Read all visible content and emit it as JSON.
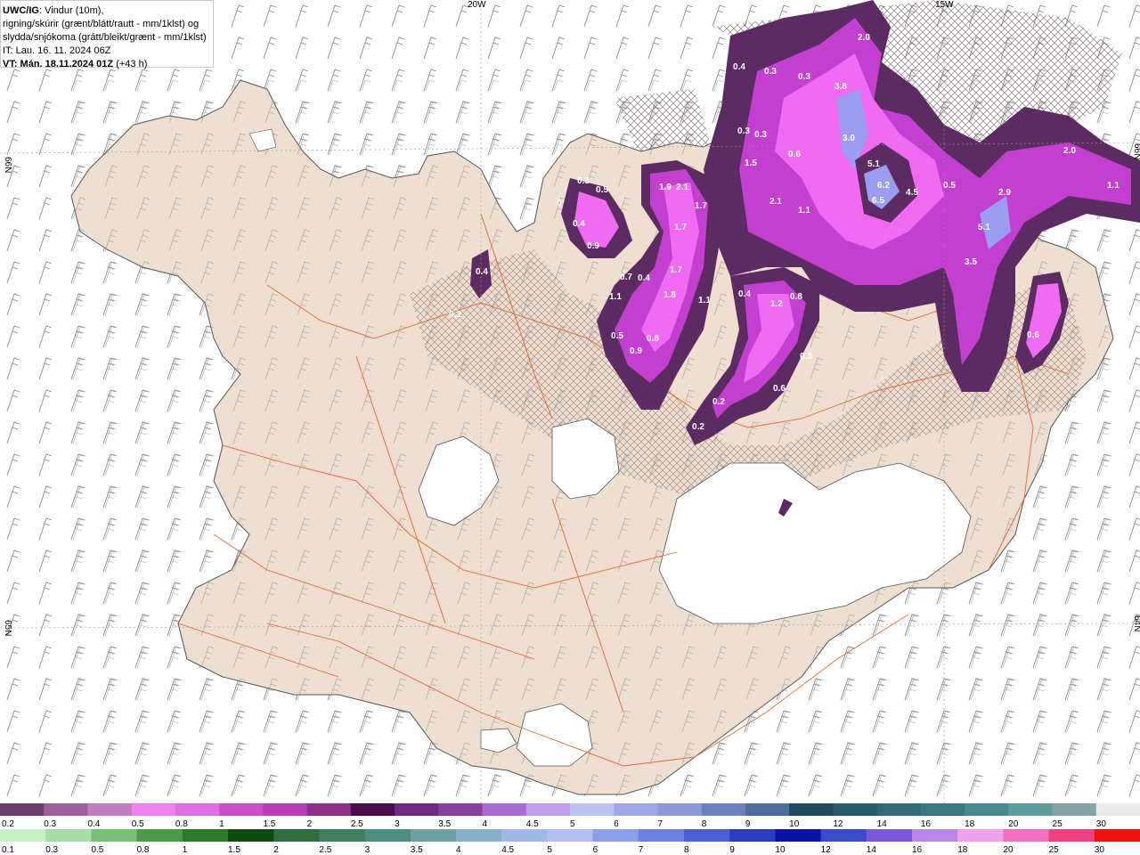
{
  "header": {
    "model": "UWC/IG",
    "line1": ": Vindur (10m),",
    "line2": "rigning/skúrir (grænt/blátt/rautt - mm/1klst) og",
    "line3": "slydda/snjókoma (grátt/bleikt/grænt - mm/1klst)",
    "issue_time": "IT: Lau. 16. 11. 2024 06Z",
    "valid_label": "VT: Mán. 18.11.2024 01Z",
    "lead": " (+43 h)"
  },
  "grid_labels": {
    "top_20w": "20W",
    "top_15w": "15W",
    "left_66n": "66N",
    "left_65n": "65N",
    "right_66n": "66N",
    "right_64n": "64N"
  },
  "colors": {
    "land": "#efdfd0",
    "sea": "#ffffff",
    "glacier": "#ffffff",
    "roads": "#e2672f",
    "coast": "#555555",
    "barbs": "#888888",
    "snow_light": "#9a4f9a",
    "snow_mid": "#c23fcf",
    "snow_bright": "#f06af2",
    "snow_dark": "#5b2b62",
    "snow_blue": "#9c9cf0"
  },
  "map_values": [
    {
      "label": "2.0"
    },
    {
      "label": "0.4"
    },
    {
      "label": "0.3"
    },
    {
      "label": "0.3"
    },
    {
      "label": "3.8"
    },
    {
      "label": "0.3"
    },
    {
      "label": "0.3"
    },
    {
      "label": "3.0"
    },
    {
      "label": "0.6"
    },
    {
      "label": "1.5"
    },
    {
      "label": "5.1"
    },
    {
      "label": "2.0"
    },
    {
      "label": "0.3"
    },
    {
      "label": "0.5"
    },
    {
      "label": "1.9"
    },
    {
      "label": "2.1"
    },
    {
      "label": "6.2"
    },
    {
      "label": "0.5"
    },
    {
      "label": "2.9"
    },
    {
      "label": "1.1"
    },
    {
      "label": "0"
    },
    {
      "label": "2.1"
    },
    {
      "label": "1.1"
    },
    {
      "label": "6.5"
    },
    {
      "label": "4.5"
    },
    {
      "label": "0.4"
    },
    {
      "label": "1.7"
    },
    {
      "label": "1.7"
    },
    {
      "label": "5.1"
    },
    {
      "label": "0.9"
    },
    {
      "label": "3.5"
    },
    {
      "label": "0.4"
    },
    {
      "label": "1.7"
    },
    {
      "label": "0.7"
    },
    {
      "label": "0.4"
    },
    {
      "label": "0.4"
    },
    {
      "label": "1.1"
    },
    {
      "label": "1.8"
    },
    {
      "label": "1.1"
    },
    {
      "label": "1.2"
    },
    {
      "label": "0.8"
    },
    {
      "label": "0.2"
    },
    {
      "label": "0.5"
    },
    {
      "label": "0.8"
    },
    {
      "label": "0.6"
    },
    {
      "label": "0.9"
    },
    {
      "label": "0.3"
    },
    {
      "label": "0.6"
    },
    {
      "label": "0.2"
    },
    {
      "label": "0.2"
    }
  ],
  "scale_snow": {
    "ticks": [
      "0.2",
      "0.3",
      "0.4",
      "0.5",
      "0.8",
      "1",
      "1.5",
      "2",
      "2.5",
      "3",
      "3.5",
      "4",
      "4.5",
      "5",
      "6",
      "7",
      "8",
      "9",
      "10",
      "12",
      "14",
      "16",
      "18",
      "20",
      "25",
      "30"
    ],
    "colors": [
      "#6b3e6b",
      "#9c5f9c",
      "#c07dc0",
      "#ee82ee",
      "#e070e0",
      "#c94fc9",
      "#b53db5",
      "#8a2f8a",
      "#4a0c4a",
      "#6e2a80",
      "#8a3f9e",
      "#a86bd0",
      "#c0a0e8",
      "#bcc4f4",
      "#a0a8e6",
      "#8c9ad6",
      "#6c80bc",
      "#4c6c9c",
      "#1e4c5c",
      "#265b68",
      "#2f6a75",
      "#3a7880",
      "#4a8a8e",
      "#5f9c9c",
      "#86a4a4",
      "#e8ecec"
    ]
  },
  "scale_rain": {
    "ticks": [
      "0.1",
      "0.3",
      "0.5",
      "0.8",
      "1",
      "1.5",
      "2",
      "2.5",
      "3",
      "3.5",
      "4",
      "4.5",
      "5",
      "6",
      "7",
      "8",
      "9",
      "10",
      "12",
      "14",
      "16",
      "18",
      "20",
      "25",
      "30"
    ],
    "colors": [
      "#c8f0c8",
      "#a8dca8",
      "#78c078",
      "#4a9a4a",
      "#2a7a2a",
      "#0e4a0e",
      "#2e6e3e",
      "#3e7e5e",
      "#4e8e7e",
      "#6ea0a0",
      "#8ab0c8",
      "#a0b8e8",
      "#b0c0f0",
      "#8ca0e8",
      "#6c80e0",
      "#4a60d0",
      "#2a3cc0",
      "#0a10a8",
      "#3a4acc",
      "#7a58d8",
      "#b888e8",
      "#f0a0e8",
      "#f070c0",
      "#f04080",
      "#f01010"
    ]
  }
}
